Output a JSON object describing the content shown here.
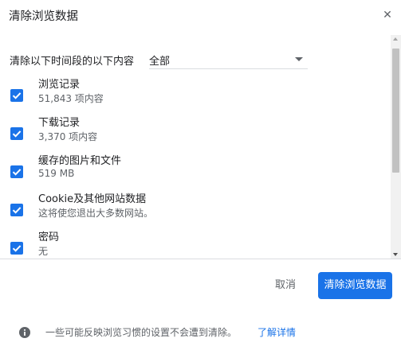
{
  "dialog": {
    "title": "清除浏览数据",
    "close_icon": "close-icon"
  },
  "time_range": {
    "label": "清除以下时间段的以下内容",
    "selected": "全部"
  },
  "items": [
    {
      "label": "浏览记录",
      "detail": "51,843 项内容",
      "checked": true
    },
    {
      "label": "下载记录",
      "detail": "3,370 项内容",
      "checked": true
    },
    {
      "label": "缓存的图片和文件",
      "detail": "519 MB",
      "checked": true
    },
    {
      "label": "Cookie及其他网站数据",
      "detail": "这将使您退出大多数网站。",
      "checked": true
    },
    {
      "label": "密码",
      "detail": "无",
      "checked": true
    }
  ],
  "buttons": {
    "cancel": "取消",
    "clear": "清除浏览数据"
  },
  "footer": {
    "info_icon": "info-icon",
    "text": "一些可能反映浏览习惯的设置不会遭到清除。",
    "link": "了解详情"
  },
  "colors": {
    "accent": "#1a73e8",
    "secondary_text": "#5f6368",
    "divider": "#dadce0"
  }
}
